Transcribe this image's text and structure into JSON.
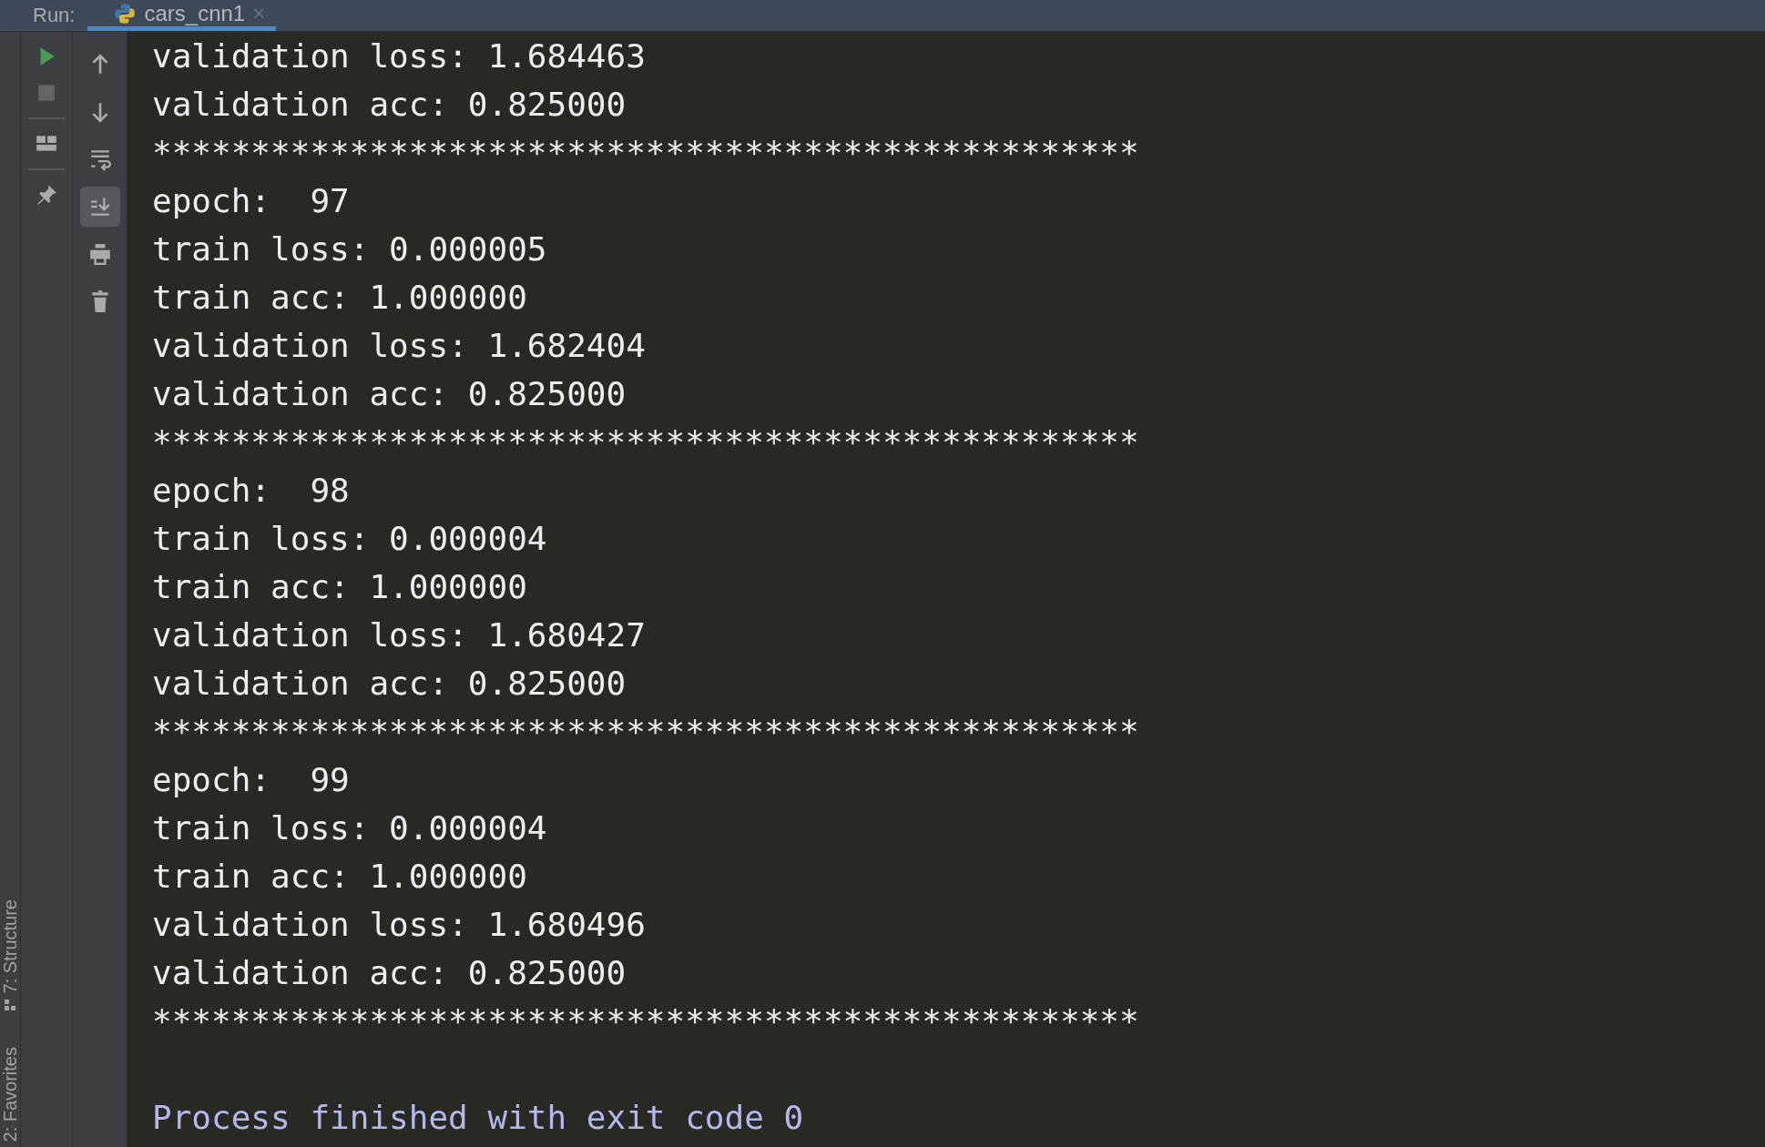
{
  "run_panel": {
    "label": "Run:",
    "tabs": [
      {
        "title": "cars_cnn1",
        "close": "×",
        "selected": true
      }
    ]
  },
  "side_tools": [
    {
      "label": "7: Structure",
      "kind": "structure"
    },
    {
      "label": "2: Favorites",
      "kind": "favorites"
    }
  ],
  "toolbar_primary": [
    {
      "kind": "run",
      "disabled": false
    },
    {
      "kind": "stop",
      "disabled": true
    },
    {
      "kind": "separator"
    },
    {
      "kind": "layout",
      "disabled": false
    },
    {
      "kind": "separator"
    },
    {
      "kind": "pin",
      "disabled": false
    }
  ],
  "toolbar_secondary": [
    {
      "kind": "up",
      "on": false
    },
    {
      "kind": "down",
      "on": false
    },
    {
      "kind": "wrap",
      "on": false
    },
    {
      "kind": "scroll-end",
      "on": true
    },
    {
      "kind": "print",
      "on": false
    },
    {
      "kind": "delete",
      "on": false
    }
  ],
  "console": [
    {
      "kind": "output",
      "text": "validation loss: 1.684463"
    },
    {
      "kind": "output",
      "text": "validation acc: 0.825000"
    },
    {
      "kind": "output",
      "text": "**************************************************"
    },
    {
      "kind": "output",
      "text": "epoch:  97"
    },
    {
      "kind": "output",
      "text": "train loss: 0.000005"
    },
    {
      "kind": "output",
      "text": "train acc: 1.000000"
    },
    {
      "kind": "output",
      "text": "validation loss: 1.682404"
    },
    {
      "kind": "output",
      "text": "validation acc: 0.825000"
    },
    {
      "kind": "output",
      "text": "**************************************************"
    },
    {
      "kind": "output",
      "text": "epoch:  98"
    },
    {
      "kind": "output",
      "text": "train loss: 0.000004"
    },
    {
      "kind": "output",
      "text": "train acc: 1.000000"
    },
    {
      "kind": "output",
      "text": "validation loss: 1.680427"
    },
    {
      "kind": "output",
      "text": "validation acc: 0.825000"
    },
    {
      "kind": "output",
      "text": "**************************************************"
    },
    {
      "kind": "output",
      "text": "epoch:  99"
    },
    {
      "kind": "output",
      "text": "train loss: 0.000004"
    },
    {
      "kind": "output",
      "text": "train acc: 1.000000"
    },
    {
      "kind": "output",
      "text": "validation loss: 1.680496"
    },
    {
      "kind": "output",
      "text": "validation acc: 0.825000"
    },
    {
      "kind": "output",
      "text": "**************************************************"
    },
    {
      "kind": "blank"
    },
    {
      "kind": "exit",
      "text": "Process finished with exit code 0"
    }
  ]
}
